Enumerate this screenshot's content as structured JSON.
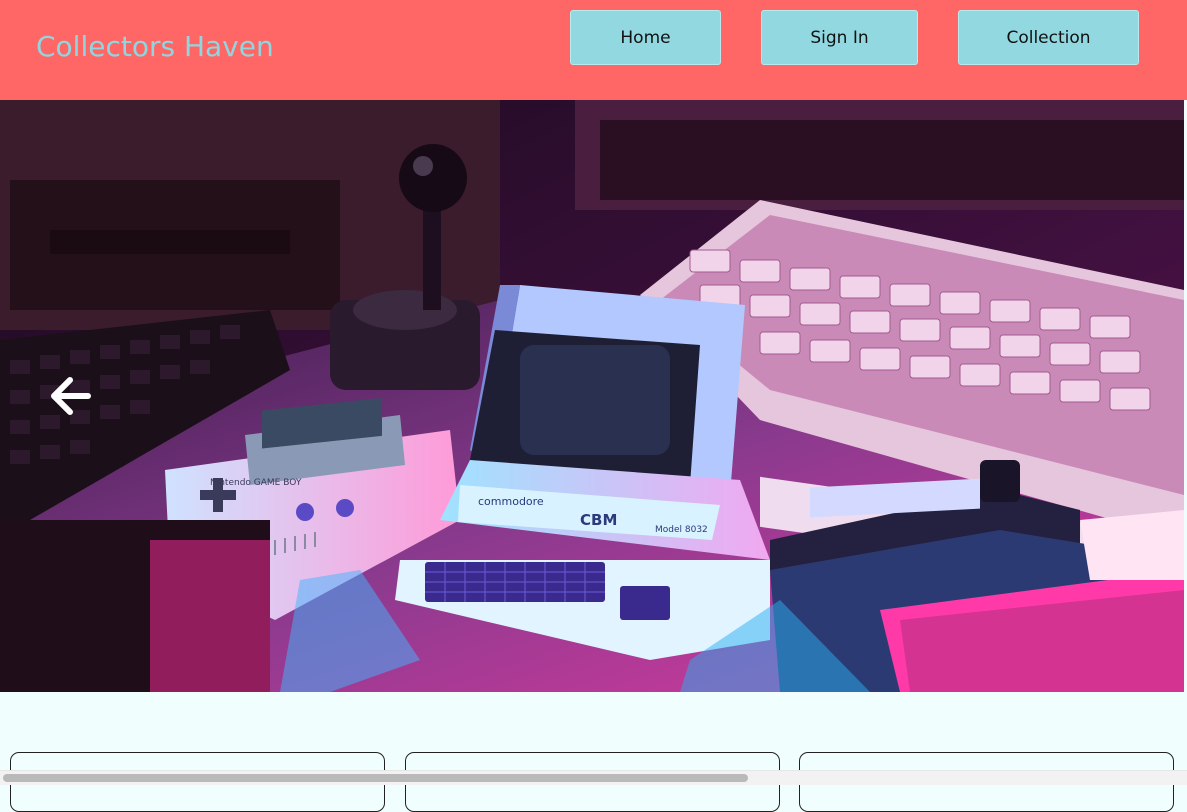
{
  "header": {
    "brand": "Collectors Haven",
    "nav": {
      "home_label": "Home",
      "signin_label": "Sign In",
      "collection_label": "Collection"
    }
  },
  "hero": {
    "prev_icon": "arrow-left-icon",
    "image_subject": "retro-computers-image",
    "device_labels": {
      "cbm": "CBM",
      "brand": "commodore",
      "model": "Model 8032",
      "gameboy": "Nintendo GAME BOY"
    }
  },
  "colors": {
    "navbar_bg": "#ff6666",
    "brand_text": "#8fd6de",
    "button_bg": "#92d8e0",
    "page_bg": "#f0fffd"
  }
}
